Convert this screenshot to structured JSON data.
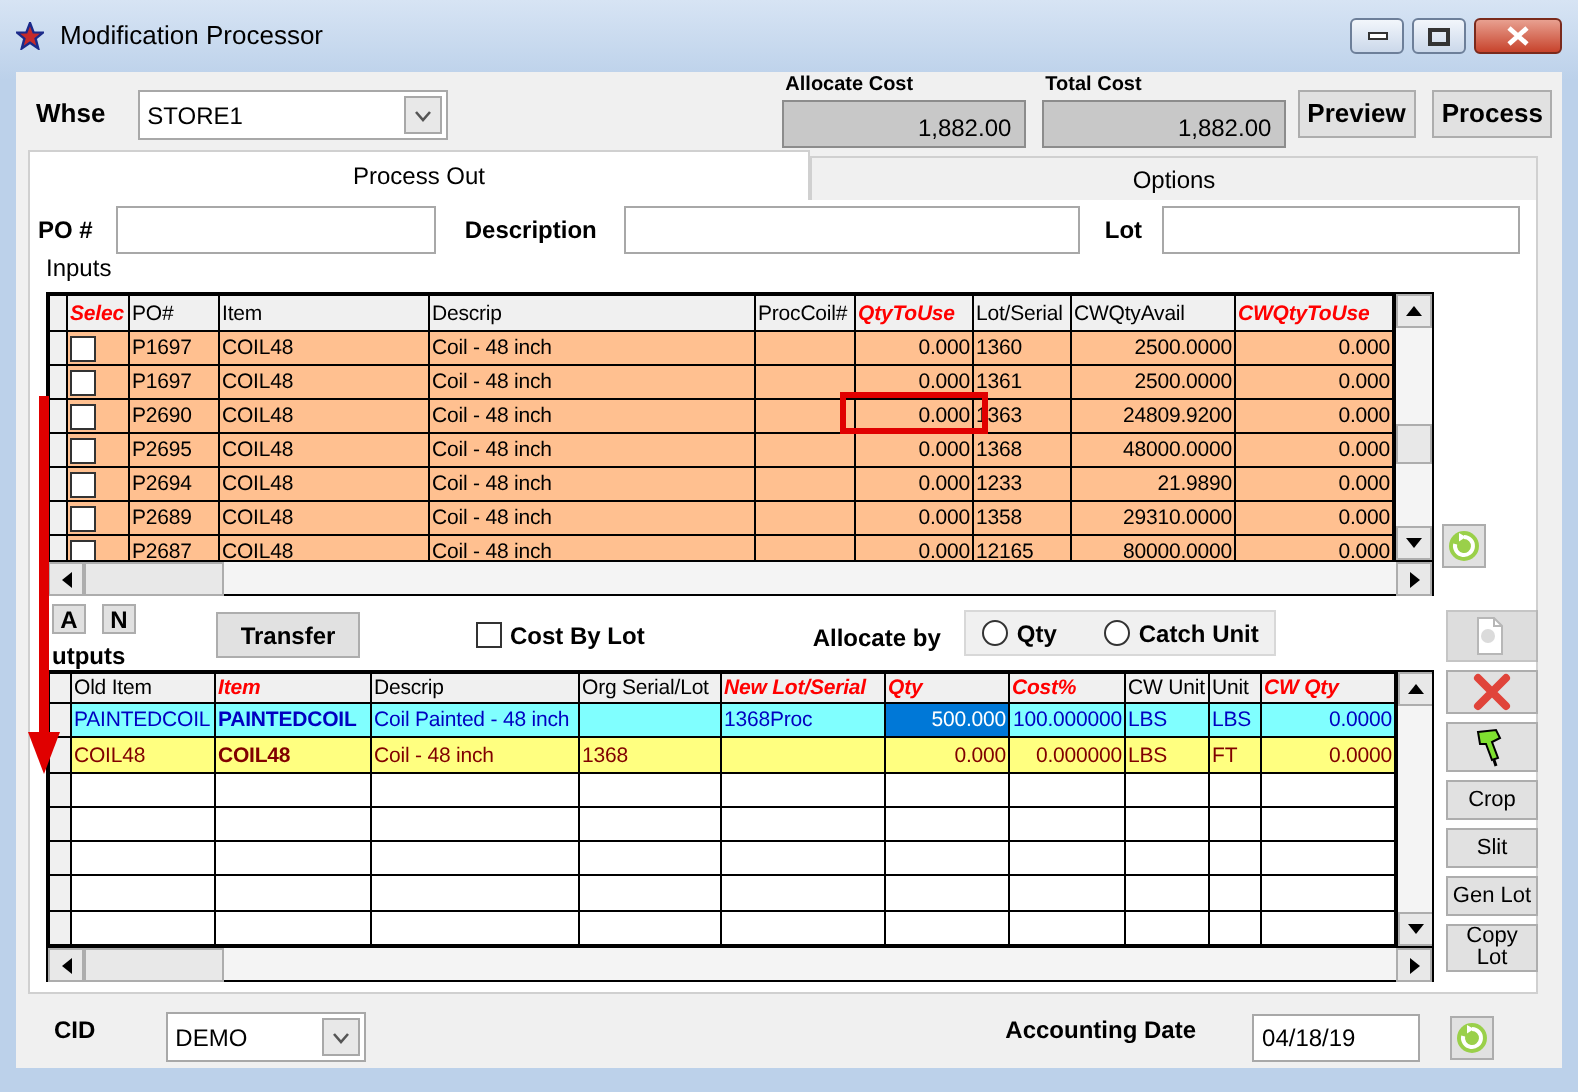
{
  "window": {
    "title": "Modification Processor"
  },
  "whse": {
    "label": "Whse",
    "value": "STORE1"
  },
  "costs": [
    {
      "label": "Allocate Cost",
      "value": "1,882.00"
    },
    {
      "label": "Total Cost",
      "value": "1,882.00"
    }
  ],
  "buttons": [
    "Preview",
    "Process"
  ],
  "tabs": [
    {
      "label": "Process Out",
      "selected": true
    },
    {
      "label": "Options",
      "selected": false
    }
  ],
  "filters": [
    {
      "label": "PO #"
    },
    {
      "label": "Description"
    },
    {
      "label": "Lot"
    }
  ],
  "inputs": {
    "label": "Inputs",
    "columns": [
      {
        "label": "Selec",
        "kind": "check",
        "required": true
      },
      {
        "label": "PO#",
        "kind": "text",
        "required": false
      },
      {
        "label": "Item",
        "kind": "text",
        "required": false
      },
      {
        "label": "Descrip",
        "kind": "text",
        "required": false
      },
      {
        "label": "ProcCoil#",
        "kind": "text",
        "required": false
      },
      {
        "label": "QtyToUse",
        "kind": "number",
        "required": true
      },
      {
        "label": "Lot/Serial",
        "kind": "text",
        "required": false
      },
      {
        "label": "CWQtyAvail",
        "kind": "number",
        "required": false
      },
      {
        "label": "CWQtyToUse",
        "kind": "number",
        "required": true
      }
    ],
    "rows": [
      {
        "cells": [
          {
            "checked": false
          },
          "P1697",
          "COIL48",
          "Coil - 48 inch",
          "",
          "0.000",
          "1360",
          "2500.0000",
          "0.000"
        ]
      },
      {
        "cells": [
          {
            "checked": false
          },
          "P1697",
          "COIL48",
          "Coil - 48 inch",
          "",
          "0.000",
          "1361",
          "2500.0000",
          "0.000"
        ]
      },
      {
        "cells": [
          {
            "checked": false
          },
          "P2690",
          "COIL48",
          "Coil - 48 inch",
          "",
          "0.000",
          "1363",
          "24809.9200",
          "0.000"
        ]
      },
      {
        "cells": [
          {
            "checked": false
          },
          "P2695",
          "COIL48",
          "Coil - 48 inch",
          "",
          "0.000",
          "1368",
          "48000.0000",
          "0.000"
        ]
      },
      {
        "cells": [
          {
            "checked": false
          },
          "P2694",
          "COIL48",
          "Coil - 48 inch",
          "",
          "0.000",
          "1233",
          "21.9890",
          "0.000"
        ]
      },
      {
        "cells": [
          {
            "checked": false
          },
          "P2689",
          "COIL48",
          "Coil - 48 inch",
          "",
          "0.000",
          "1358",
          "29310.0000",
          "0.000"
        ]
      },
      {
        "cells": [
          {
            "checked": false
          },
          "P2687",
          "COIL48",
          "Coil - 48 inch",
          "",
          "0.000",
          "12165",
          "80000.0000",
          "0.000"
        ]
      }
    ]
  },
  "small_buttons": [
    "A",
    "N"
  ],
  "outputs": {
    "label": "utputs",
    "transfer": {
      "label": "Transfer"
    },
    "cost_by_lot": {
      "label": "Cost By Lot",
      "checked": false
    },
    "allocate_by": {
      "label": "Allocate by",
      "options": [
        {
          "label": "Qty",
          "selected": false
        },
        {
          "label": "Catch Unit",
          "selected": false
        }
      ]
    },
    "columns": [
      {
        "label": "Old Item",
        "kind": "text",
        "required": false
      },
      {
        "label": "Item",
        "kind": "bold",
        "required": true
      },
      {
        "label": "Descrip",
        "kind": "text",
        "required": false
      },
      {
        "label": "Org Serial/Lot",
        "kind": "text",
        "required": false
      },
      {
        "label": "New Lot/Serial",
        "kind": "text",
        "required": true
      },
      {
        "label": "Qty",
        "kind": "number",
        "required": true
      },
      {
        "label": "Cost%",
        "kind": "number",
        "required": true
      },
      {
        "label": "CW Unit",
        "kind": "text",
        "required": false
      },
      {
        "label": "Unit",
        "kind": "text",
        "required": false
      },
      {
        "label": "CW Qty",
        "kind": "number",
        "required": true
      }
    ],
    "rows": [
      {
        "kind": "new",
        "cells": [
          {
            "text": "PAINTEDCOIL",
            "selected": false
          },
          {
            "text": "PAINTEDCOIL",
            "selected": false
          },
          {
            "text": "Coil Painted - 48 inch",
            "selected": false
          },
          {
            "selected": false
          },
          {
            "text": "1368Proc",
            "selected": false
          },
          {
            "text": "500.000",
            "selected": true
          },
          {
            "text": "100.000000",
            "selected": false
          },
          {
            "text": "LBS",
            "selected": false
          },
          {
            "text": "LBS",
            "selected": false
          },
          {
            "text": "0.0000",
            "selected": false
          }
        ]
      },
      {
        "kind": "old",
        "cells": [
          {
            "text": "COIL48",
            "selected": false
          },
          {
            "text": "COIL48",
            "selected": false
          },
          {
            "text": "Coil - 48 inch",
            "selected": false
          },
          {
            "text": "1368",
            "selected": false
          },
          {
            "selected": false
          },
          {
            "text": "0.000",
            "selected": false
          },
          {
            "text": "0.000000",
            "selected": false
          },
          {
            "text": "LBS",
            "selected": false
          },
          {
            "text": "FT",
            "selected": false
          },
          {
            "text": "0.0000",
            "selected": false
          }
        ]
      }
    ]
  },
  "icon_buttons": [
    {
      "disabled": true
    },
    {
      "disabled": false
    },
    {
      "disabled": false
    }
  ],
  "text_buttons": [
    "Crop",
    "Slit",
    "Gen Lot",
    "Copy Lot"
  ],
  "cid": {
    "label": "CID",
    "value": "DEMO"
  },
  "accounting_date": {
    "label": "Accounting Date",
    "value": "04/18/19"
  }
}
